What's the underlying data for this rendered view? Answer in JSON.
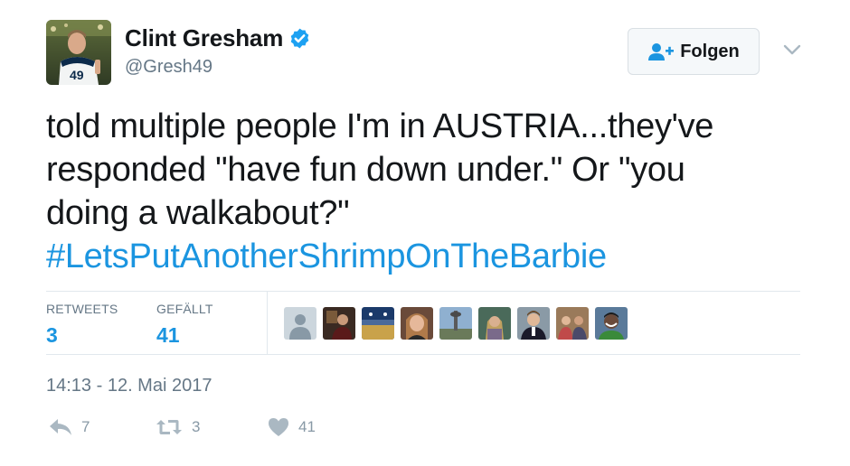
{
  "author": {
    "display_name": "Clint Gresham",
    "handle": "@Gresh49",
    "verified": true,
    "avatar_jersey_number": "49"
  },
  "follow_button": {
    "label": "Folgen"
  },
  "tweet": {
    "lines": [
      "told multiple people I'm in AUSTRIA...they've",
      "responded \"have fun down under.\" Or \"you",
      "doing a walkabout?\""
    ],
    "hashtag": "#LetsPutAnotherShrimpOnTheBarbie"
  },
  "stats": {
    "retweets_label": "RETWEETS",
    "retweets_value": "3",
    "likes_label": "GEFÄLLT",
    "likes_value": "41"
  },
  "timestamp": "14:13 - 12. Mai 2017",
  "actions": {
    "reply_count": "7",
    "retweet_count": "3",
    "like_count": "41"
  },
  "colors": {
    "link": "#1b95e0",
    "verified": "#1da1f2",
    "secondary_text": "#657786",
    "action_icon": "#aab8c2"
  },
  "liker_avatars": [
    "default-avatar-icon",
    "liker-photo",
    "liker-photo",
    "liker-photo",
    "liker-photo",
    "liker-photo",
    "liker-photo",
    "liker-photo",
    "liker-photo"
  ]
}
